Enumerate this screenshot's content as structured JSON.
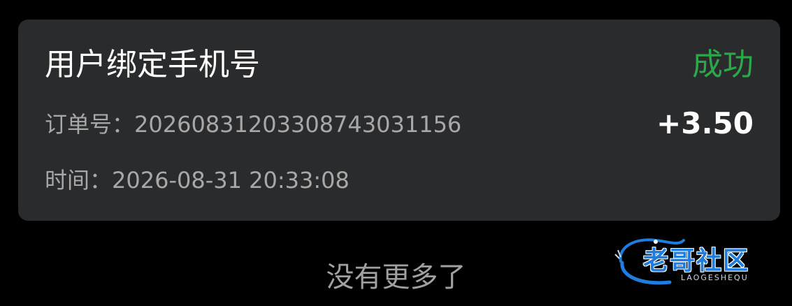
{
  "card": {
    "title": "用户绑定手机号",
    "status": "成功",
    "order_label": "订单号：",
    "order_number": "20260831203308743031156",
    "amount": "+3.50",
    "time_label": "时间：",
    "time_value": "2026-08-31 20:33:08"
  },
  "footer": {
    "text": "没有更多了"
  },
  "watermark": {
    "text": "老哥社区",
    "subtext": "LAOGESHEQU"
  },
  "colors": {
    "background": "#000000",
    "card_bg": "#2a2b2d",
    "success": "#2aa84a",
    "secondary_text": "#a8a8a8",
    "watermark_blue": "#1f7de0"
  }
}
